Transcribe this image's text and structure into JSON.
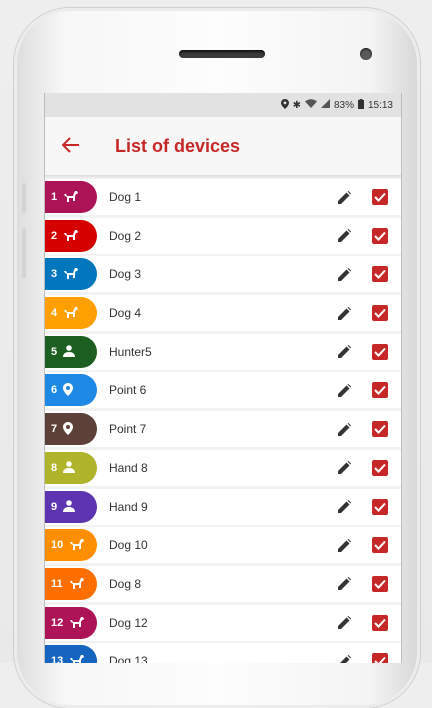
{
  "status": {
    "battery_percent": "83%",
    "time": "15:13"
  },
  "header": {
    "title": "List of devices"
  },
  "devices": [
    {
      "number": "1",
      "name": "Dog 1",
      "type": "dog",
      "color": "#ad1457",
      "checked": true
    },
    {
      "number": "2",
      "name": "Dog 2",
      "type": "dog",
      "color": "#d50000",
      "checked": true
    },
    {
      "number": "3",
      "name": "Dog 3",
      "type": "dog",
      "color": "#0277bd",
      "checked": true
    },
    {
      "number": "4",
      "name": "Dog 4",
      "type": "dog",
      "color": "#ffa000",
      "checked": true
    },
    {
      "number": "5",
      "name": "Hunter5",
      "type": "person",
      "color": "#1b5e20",
      "checked": true
    },
    {
      "number": "6",
      "name": "Point 6",
      "type": "point",
      "color": "#1e88e5",
      "checked": true
    },
    {
      "number": "7",
      "name": "Point 7",
      "type": "point",
      "color": "#5d4037",
      "checked": true
    },
    {
      "number": "8",
      "name": "Hand 8",
      "type": "person",
      "color": "#afb42b",
      "checked": true
    },
    {
      "number": "9",
      "name": "Hand 9",
      "type": "person",
      "color": "#5e35b1",
      "checked": true
    },
    {
      "number": "10",
      "name": "Dog 10",
      "type": "dog",
      "color": "#ff8f00",
      "checked": true
    },
    {
      "number": "11",
      "name": "Dog 8",
      "type": "dog",
      "color": "#ff6f00",
      "checked": true
    },
    {
      "number": "12",
      "name": "Dog 12",
      "type": "dog",
      "color": "#ad1457",
      "checked": true
    },
    {
      "number": "13",
      "name": "Dog 13",
      "type": "dog",
      "color": "#1565c0",
      "checked": true
    }
  ],
  "icons": {
    "back": "arrow-left-icon",
    "edit": "pencil-icon",
    "check": "checkbox-checked-icon",
    "dog": "dog-icon",
    "person": "person-icon",
    "point": "location-pin-icon"
  },
  "colors": {
    "accent": "#c62828"
  }
}
